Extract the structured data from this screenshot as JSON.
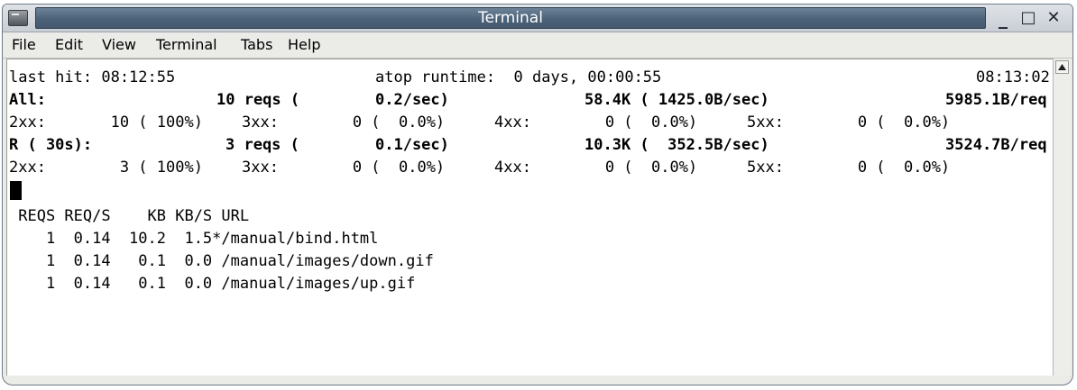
{
  "window": {
    "title": "Terminal",
    "controls": {
      "minimize": "_",
      "maximize": "□",
      "close": "✕"
    }
  },
  "menu": [
    "File",
    "Edit",
    "View",
    "Terminal",
    "Tabs",
    "Help"
  ],
  "terminal": {
    "status_line": {
      "last_hit": "last hit: 08:12:55",
      "uptime": "atop runtime:  0 days, 00:00:55",
      "clock": "08:13:02"
    },
    "all": {
      "label": "All:",
      "reqs": "10 reqs (",
      "rate": "0.2/sec)",
      "bytes": "58.4K ( 1425.0B/sec)",
      "per_req": "5985.1B/req"
    },
    "all_codes": {
      "c2xx": "2xx:       10 ( 100%)",
      "c3xx": "3xx:        0 (  0.0%)",
      "c4xx": "4xx:        0 (  0.0%)",
      "c5xx": "5xx:        0 (  0.0%)"
    },
    "recent": {
      "label": "R ( 30s):",
      "reqs": "3 reqs (",
      "rate": "0.1/sec)",
      "bytes": "10.3K (  352.5B/sec)",
      "per_req": "3524.7B/req"
    },
    "recent_codes": {
      "c2xx": "2xx:        3 ( 100%)",
      "c3xx": "3xx:        0 (  0.0%)",
      "c4xx": "4xx:        0 (  0.0%)",
      "c5xx": "5xx:        0 (  0.0%)"
    },
    "table_header": " REQS REQ/S    KB KB/S URL",
    "rows": [
      "    1  0.14  10.2  1.5*/manual/bind.html",
      "    1  0.14   0.1  0.0 /manual/images/down.gif",
      "    1  0.14   0.1  0.0 /manual/images/up.gif"
    ]
  }
}
